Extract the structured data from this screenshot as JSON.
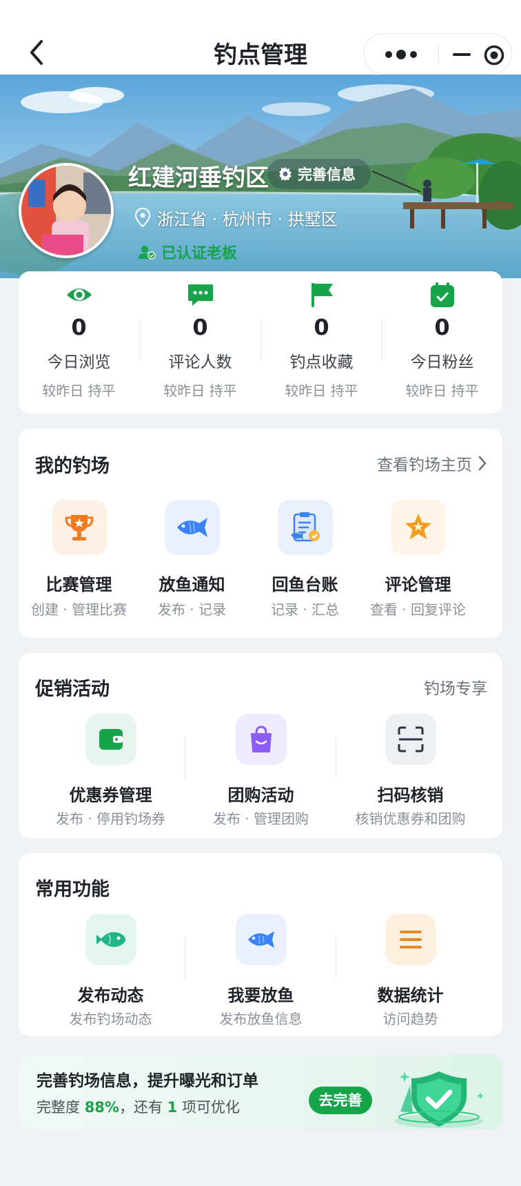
{
  "header": {
    "title": "钓点管理"
  },
  "hero": {
    "spot_name": "红建河垂钓区",
    "complete_info_label": "完善信息",
    "location": "浙江省 · 杭州市 · 拱墅区",
    "verified_label": "已认证老板"
  },
  "stats": [
    {
      "icon": "eye-icon",
      "value": "0",
      "label": "今日浏览",
      "compare": "较昨日 持平"
    },
    {
      "icon": "comment-icon",
      "value": "0",
      "label": "评论人数",
      "compare": "较昨日 持平"
    },
    {
      "icon": "flag-icon",
      "value": "0",
      "label": "钓点收藏",
      "compare": "较昨日 持平"
    },
    {
      "icon": "calendar-icon",
      "value": "0",
      "label": "今日粉丝",
      "compare": "较昨日 持平"
    }
  ],
  "my_spot": {
    "title": "我的钓场",
    "link_label": "查看钓场主页",
    "items": [
      {
        "icon": "trophy-icon",
        "name": "比赛管理",
        "desc": "创建 · 管理比赛"
      },
      {
        "icon": "fish-icon",
        "name": "放鱼通知",
        "desc": "发布 · 记录"
      },
      {
        "icon": "clipboard-icon",
        "name": "回鱼台账",
        "desc": "记录 · 汇总"
      },
      {
        "icon": "star-icon",
        "name": "评论管理",
        "desc": "查看 · 回复评论"
      }
    ]
  },
  "promo": {
    "title": "促销活动",
    "tag": "钓场专享",
    "items": [
      {
        "icon": "wallet-icon",
        "name": "优惠券管理",
        "desc": "发布 · 停用钓场券"
      },
      {
        "icon": "shopping-bag-icon",
        "name": "团购活动",
        "desc": "发布 · 管理团购"
      },
      {
        "icon": "scan-icon",
        "name": "扫码核销",
        "desc": "核销优惠券和团购"
      }
    ]
  },
  "common": {
    "title": "常用功能",
    "items": [
      {
        "icon": "fish-post-icon",
        "name": "发布动态",
        "desc": "发布钓场动态"
      },
      {
        "icon": "fish-release-icon",
        "name": "我要放鱼",
        "desc": "发布放鱼信息"
      },
      {
        "icon": "menu-lines-icon",
        "name": "数据统计",
        "desc": "访问趋势"
      }
    ]
  },
  "banner": {
    "title": "完善钓场信息，提升曝光和订单",
    "prefix": "完整度",
    "percent": "88%",
    "middle": "，还有",
    "count": "1",
    "suffix": "项可优化",
    "button_label": "去完善"
  },
  "colors": {
    "accent": "#16a34a",
    "background": "#eef2f5"
  }
}
